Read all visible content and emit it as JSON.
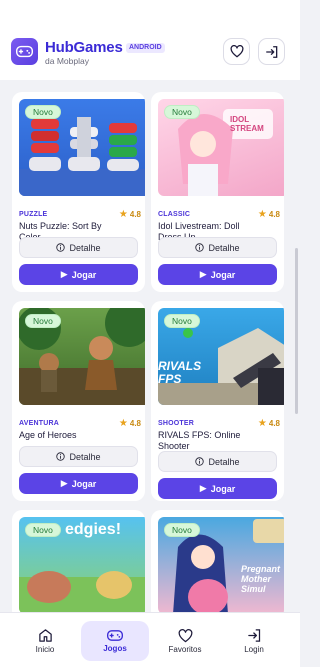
{
  "header": {
    "brand": "HubGames",
    "badge": "ANDROID",
    "subtitle": "da Mobplay"
  },
  "games": [
    {
      "badge": "Novo",
      "category": "PUZZLE",
      "rating": "4.8",
      "title": "Nuts Puzzle: Sort By Color",
      "details_label": "Detalhe",
      "play_label": "Jogar"
    },
    {
      "badge": "Novo",
      "category": "CLASSIC",
      "rating": "4.8",
      "title": "Idol Livestream: Doll Dress Up",
      "details_label": "Detalhe",
      "play_label": "Jogar",
      "thumb_text": "IDOL STREAM"
    },
    {
      "badge": "Novo",
      "category": "AVENTURA",
      "rating": "4.8",
      "title": "Age of Heroes",
      "details_label": "Detalhe",
      "play_label": "Jogar"
    },
    {
      "badge": "Novo",
      "category": "SHOOTER",
      "rating": "4.8",
      "title": "RIVALS FPS: Online Shooter",
      "details_label": "Detalhe",
      "play_label": "Jogar",
      "thumb_text": "RIVALS FPS"
    },
    {
      "badge": "Novo",
      "thumb_text": "edgies!"
    },
    {
      "badge": "Novo",
      "thumb_text": "Pregnant Mother Simul"
    }
  ],
  "nav": [
    {
      "label": "Inicio",
      "icon": "home-icon",
      "active": false
    },
    {
      "label": "Jogos",
      "icon": "gamepad-icon",
      "active": true
    },
    {
      "label": "Favoritos",
      "icon": "heart-icon",
      "active": false
    },
    {
      "label": "Login",
      "icon": "login-icon",
      "active": false
    }
  ],
  "colors": {
    "primary": "#5b44e6",
    "accent": "#3b2bd6",
    "novo_bg": "#d7f7d9",
    "star": "#e8a21c"
  }
}
